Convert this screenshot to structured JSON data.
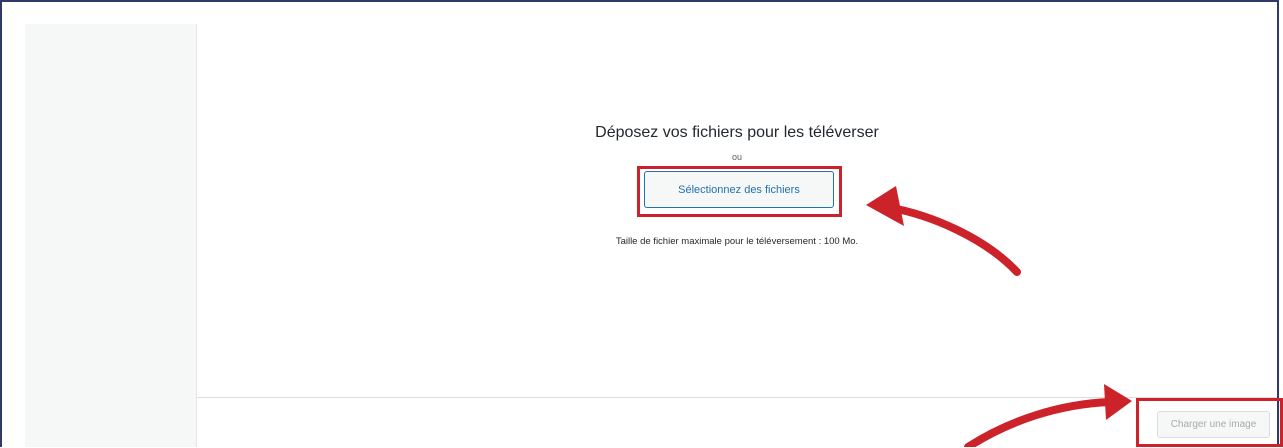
{
  "upload": {
    "drop_title": "Déposez vos fichiers pour les téléverser",
    "or_label": "ou",
    "select_button_label": "Sélectionnez des fichiers",
    "max_size_text": "Taille de fichier maximale pour le téléversement : 100 Mo."
  },
  "toolbar": {
    "charger_button_label": "Charger une image"
  },
  "colors": {
    "annotation_red": "#cc2229",
    "accent_blue": "#2271b1",
    "frame_border": "#2f3a6b"
  },
  "annotations": {
    "icons": [
      "curved-arrow-icon",
      "curved-arrow-icon"
    ]
  }
}
